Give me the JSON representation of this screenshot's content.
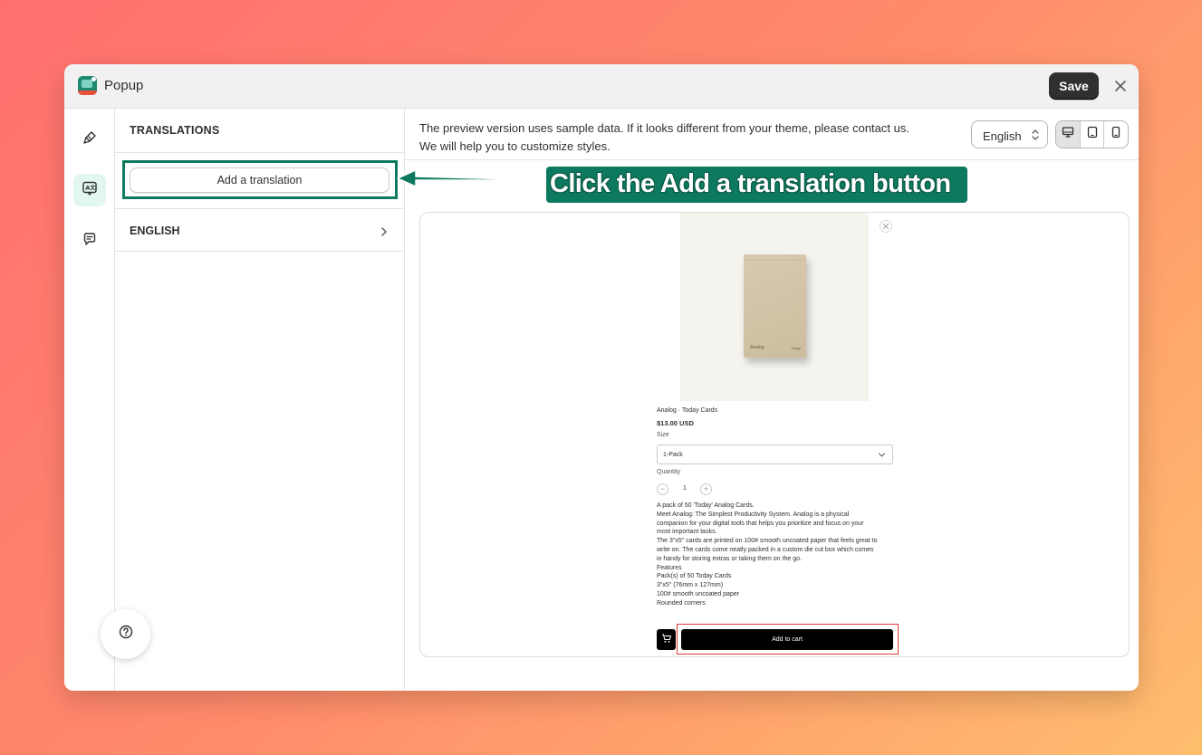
{
  "window": {
    "title": "Popup"
  },
  "toolbar": {
    "save_label": "Save"
  },
  "rail": {
    "items": [
      {
        "icon": "brush-icon"
      },
      {
        "icon": "translate-icon",
        "active": true
      },
      {
        "icon": "comment-icon"
      }
    ]
  },
  "panel": {
    "heading": "TRANSLATIONS",
    "add_button_label": "Add a translation",
    "languages": [
      {
        "label": "ENGLISH"
      }
    ]
  },
  "main": {
    "notice_line1": "The preview version uses sample data. If it looks different from your theme, please contact us.",
    "notice_line2": "We will help you to customize styles.",
    "locale_selected": "English",
    "devices": [
      {
        "icon": "desktop-icon",
        "active": true
      },
      {
        "icon": "tablet-icon"
      },
      {
        "icon": "mobile-icon"
      }
    ]
  },
  "preview": {
    "product_title": "Analog · Today Cards",
    "price": "$13.00 USD",
    "size_label": "Size",
    "size_selected": "1-Pack",
    "quantity_label": "Quantity",
    "quantity_value": "1",
    "description": [
      "A pack of 50 'Today' Analog Cards.",
      "Meet Analog: The Simplest Productivity System. Analog is a physical",
      "companion for your digital tools that helps you prioritize and focus on your",
      "most important tasks.",
      "The 3\"x5\" cards are printed on 100# smooth uncoated paper that feels great to",
      "write on. The cards come neatly packed in a custom die cut box which comes",
      "in handy for storing extras or taking them on the go.",
      "Features",
      "Pack(s) of 50 Today Cards",
      "3\"x5\" (76mm x 127mm)",
      "100# smooth uncoated paper",
      "Rounded corners"
    ],
    "add_to_cart_label": "Add to cart",
    "box_brand": "Analog",
    "box_tag": "Today"
  },
  "annotation": {
    "callout_text": "Click the Add a translation button"
  },
  "colors": {
    "accent": "#0d7a5f",
    "highlight_red": "#e53935",
    "save_bg": "#303030"
  }
}
